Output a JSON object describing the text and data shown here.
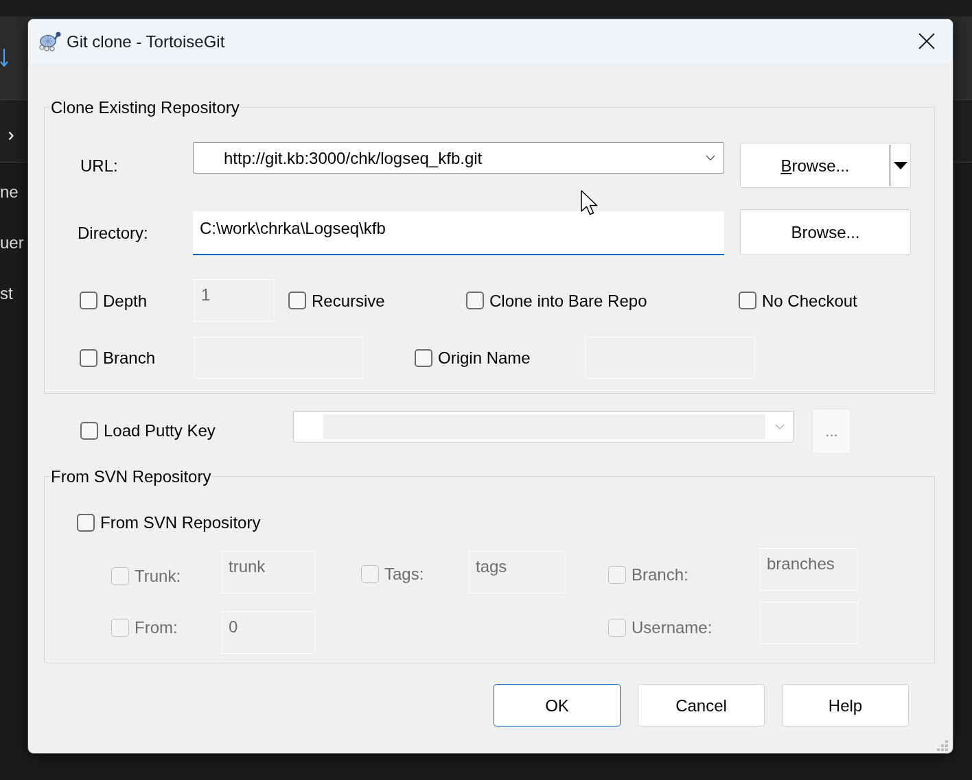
{
  "background_app": {
    "sidebar_items": [
      "ne",
      "uer",
      "st"
    ]
  },
  "window": {
    "title": "Git clone - TortoiseGit"
  },
  "clone_group": {
    "title": "Clone Existing Repository",
    "url": {
      "label": "URL:",
      "value": "http://git.kb:3000/chk/logseq_kfb.git",
      "button": {
        "label": "Browse...",
        "mnemonic_underlined": true,
        "has_dropdown": true
      }
    },
    "directory": {
      "label": "Directory:",
      "value": "C:\\work\\chrka\\Logseq\\kfb",
      "focused": true,
      "button": {
        "label": "Browse...",
        "mnemonic_underlined": false,
        "has_dropdown": false
      }
    },
    "depth": {
      "label": "Depth",
      "checked": false,
      "field": {
        "value": "1",
        "disabled": true
      }
    },
    "recursive": {
      "label": "Recursive",
      "checked": false
    },
    "bare_repo": {
      "label": "Clone into Bare Repo",
      "checked": false
    },
    "no_checkout": {
      "label": "No Checkout",
      "checked": false
    },
    "branch": {
      "label": "Branch",
      "checked": false,
      "field": {
        "disabled": true
      }
    },
    "origin_name": {
      "label": "Origin Name",
      "checked": false,
      "field": {
        "disabled": true
      }
    }
  },
  "putty_key": {
    "label": "Load Putty Key",
    "checked": false,
    "combo": {
      "disabled": true
    },
    "button": {
      "label": "...",
      "disabled": true
    }
  },
  "svn_group": {
    "title": "From SVN Repository",
    "from_svn": {
      "label": "From SVN Repository",
      "checked": false
    },
    "trunk": {
      "label": "Trunk:",
      "checked": false,
      "disabled": true,
      "value": "trunk"
    },
    "tags": {
      "label": "Tags:",
      "checked": false,
      "disabled": true,
      "value": "tags"
    },
    "branch": {
      "label": "Branch:",
      "checked": false,
      "disabled": true,
      "value": "branches"
    },
    "from": {
      "label": "From:",
      "checked": false,
      "disabled": true,
      "value": "0"
    },
    "username": {
      "label": "Username:",
      "checked": false,
      "disabled": true
    }
  },
  "buttons": [
    {
      "label": "OK",
      "default": true
    },
    {
      "label": "Cancel",
      "default": false
    },
    {
      "label": "Help",
      "default": false
    }
  ]
}
